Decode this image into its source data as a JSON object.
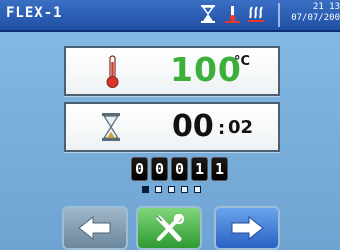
{
  "header": {
    "title": "FLEX-1",
    "time": "21 13",
    "date": "07/07/200",
    "icons": [
      "hourglass-icon",
      "thermometer-warning-icon",
      "steam-icon"
    ]
  },
  "temperature": {
    "icon": "thermometer-icon",
    "value": "100",
    "unit": "°C",
    "value_color": "#3cb03a"
  },
  "timer": {
    "icon": "hourglass-icon",
    "minutes": "00",
    "seconds": "02"
  },
  "counter": {
    "digits": [
      "0",
      "0",
      "0",
      "1",
      "1"
    ],
    "page_dots": 5,
    "active_dot": 1
  },
  "buttons": [
    {
      "name": "back",
      "icon": "arrow-left-icon"
    },
    {
      "name": "tools",
      "icon": "tools-icon"
    },
    {
      "name": "next",
      "icon": "arrow-right-icon"
    }
  ],
  "colors": {
    "title_bar": "#1f4fa6",
    "background": "#7fb3df",
    "tool_button": "#2e9a31",
    "next_button": "#2a63c4"
  }
}
